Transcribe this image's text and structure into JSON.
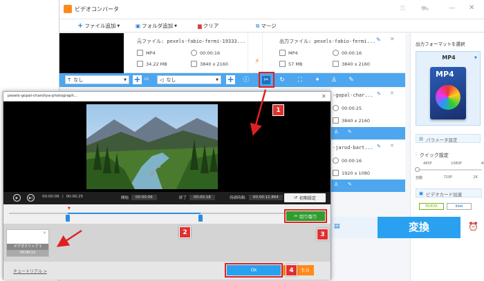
{
  "app": {
    "title": "ビデオコンバータ"
  },
  "toolbar": {
    "add_file": "ファイル追加",
    "add_folder": "フォルダ追加",
    "clear": "クリア",
    "merge": "マージ"
  },
  "file": {
    "source_label": "元ファイル: pexels-fabio-fermi-19333...",
    "source_format": "MP4",
    "source_duration": "00:00:16",
    "source_size": "34.22 MB",
    "source_resolution": "3840 x 2160",
    "output_label": "出力ファイル: pexels-fabio-fermi...",
    "output_format": "MP4",
    "output_duration": "00:00:16",
    "output_size": "57 MB",
    "output_resolution": "3840 x 2160"
  },
  "queue": [
    {
      "name": "-gopal-char...",
      "duration": "00:00:25",
      "resolution": "3840 x 2160"
    },
    {
      "name": "-jarod-bart...",
      "duration": "00:00:16",
      "resolution": "1920 x 1080"
    }
  ],
  "editbar": {
    "subtitle": "なし",
    "audio": "なし"
  },
  "right": {
    "format_label": "出力フォーマットを選択",
    "format": "MP4",
    "format_icon": "MP4",
    "param_button": "パラメータ設定",
    "quick_label": "クイック設定",
    "quality_top": [
      "480P",
      "1080P",
      "4K"
    ],
    "quality_bottom": [
      "自動",
      "720P",
      "2K"
    ],
    "gpu_label": "ビデオカード加速",
    "gpu_nvidia": "NVIDIA",
    "gpu_intel": "Intel"
  },
  "convert_button": "変換",
  "editor": {
    "title": "pexels-gopal-charoliya-photograph...",
    "current_time": "00:00:06",
    "total_time": "00:00:25",
    "start_label": "開始",
    "start_value": "00:00:06",
    "end_label": "終了",
    "end_value": "00:00:18",
    "duration_label": "持続時間:",
    "duration_value": "00:00:12.864",
    "reset_button": "初期設定",
    "cut_button": "切り取り",
    "clip_label": "ビデオクリップ 1",
    "clip_duration": "00:00:12",
    "tutorial_link": "チュートリアル >",
    "ok_button": "Ok",
    "cancel_partial": "セル"
  },
  "badges": [
    "1",
    "2",
    "3",
    "4"
  ],
  "colors": {
    "accent": "#29a1f0",
    "badge": "#e03030",
    "cut_green": "#2e9e2e"
  }
}
